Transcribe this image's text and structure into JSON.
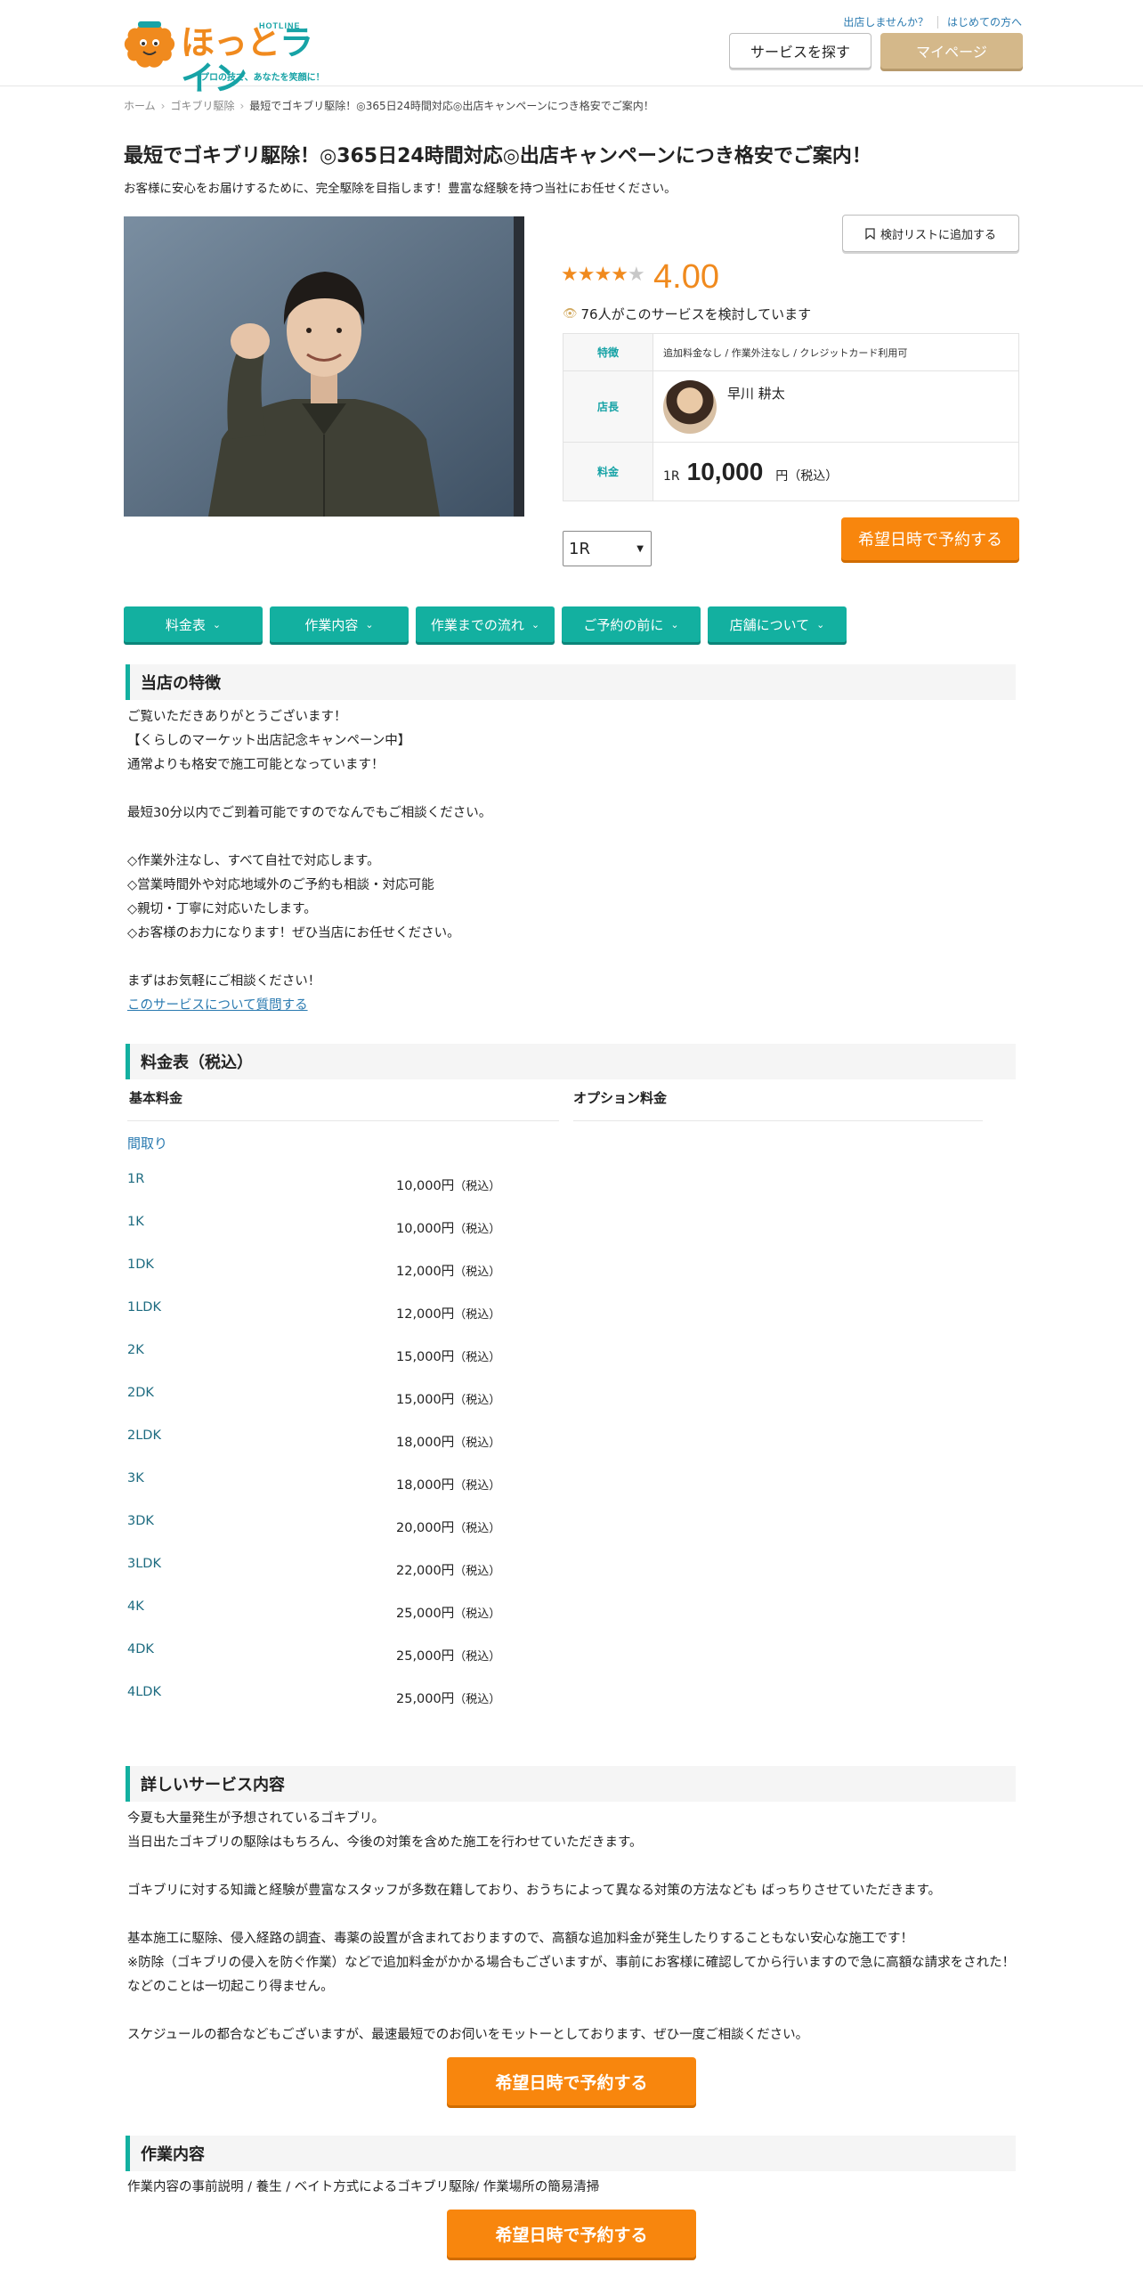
{
  "header": {
    "logo_small": "HOTLINE",
    "logo_word_1": "ほっと",
    "logo_word_2": "ライン",
    "logo_tagline": "プロの技で、あなたを笑顔に！",
    "link_open_shop": "出店しませんか？",
    "link_first_time": "はじめての方へ",
    "search_service_label": "サービスを探す",
    "mypage_label": "マイページ"
  },
  "breadcrumb": {
    "home": "ホーム",
    "category": "ゴキブリ駆除",
    "current": "最短でゴキブリ駆除！◎365日24時間対応◎出店キャンペーンにつき格安でご案内！"
  },
  "service": {
    "title": "最短でゴキブリ駆除！◎365日24時間対応◎出店キャンペーンにつき格安でご案内！",
    "subtitle": "お客様に安心をお届けするために、完全駆除を目指します！豊富な経験を持つ当社にお任せください。",
    "wishlist_label": "検討リストに追加する",
    "rating": "4.00",
    "rating_value": 4,
    "viewers_text": "76人がこのサービスを検討しています",
    "features_label": "特徴",
    "features_value": "追加料金なし / 作業外注なし / クレジットカード利用可",
    "manager_label": "店長",
    "manager_name": "早川 耕太",
    "fee_label": "料金",
    "fee_room": "1R",
    "fee_amount": "10,000",
    "fee_unit": "円（税込）",
    "select_value": "1R",
    "book_label": "希望日時で予約する"
  },
  "tabs": [
    {
      "label": "料金表"
    },
    {
      "label": "作業内容"
    },
    {
      "label": "作業までの流れ"
    },
    {
      "label": "ご予約の前に"
    },
    {
      "label": "店舗について"
    }
  ],
  "features_section": {
    "heading": "当店の特徴",
    "body": "ご覧いただきありがとうございます！\n【くらしのマーケット出店記念キャンペーン中】\n通常よりも格安で施工可能となっています！\n\n最短30分以内でご到着可能ですのでなんでもご相談ください。\n\n◇作業外注なし、すべて自社で対応します。\n◇営業時間外や対応地域外のご予約も相談・対応可能\n◇親切・丁寧に対応いたします。\n◇お客様のお力になります！ぜひ当店にお任せください。\n\nまずはお気軽にご相談ください！",
    "ask_link": "このサービスについて質問する"
  },
  "price_section": {
    "heading": "料金表（税込）",
    "basic_label": "基本料金",
    "option_label": "オプション料金",
    "category": "間取り",
    "rows": [
      {
        "room": "1R",
        "price": "10,000円",
        "tax": "（税込）"
      },
      {
        "room": "1K",
        "price": "10,000円",
        "tax": "（税込）"
      },
      {
        "room": "1DK",
        "price": "12,000円",
        "tax": "（税込）"
      },
      {
        "room": "1LDK",
        "price": "12,000円",
        "tax": "（税込）"
      },
      {
        "room": "2K",
        "price": "15,000円",
        "tax": "（税込）"
      },
      {
        "room": "2DK",
        "price": "15,000円",
        "tax": "（税込）"
      },
      {
        "room": "2LDK",
        "price": "18,000円",
        "tax": "（税込）"
      },
      {
        "room": "3K",
        "price": "18,000円",
        "tax": "（税込）"
      },
      {
        "room": "3DK",
        "price": "20,000円",
        "tax": "（税込）"
      },
      {
        "room": "3LDK",
        "price": "22,000円",
        "tax": "（税込）"
      },
      {
        "room": "4K",
        "price": "25,000円",
        "tax": "（税込）"
      },
      {
        "room": "4DK",
        "price": "25,000円",
        "tax": "（税込）"
      },
      {
        "room": "4LDK",
        "price": "25,000円",
        "tax": "（税込）"
      }
    ]
  },
  "detail_section": {
    "heading": "詳しいサービス内容",
    "body": "今夏も大量発生が予想されているゴキブリ。\n当日出たゴキブリの駆除はもちろん、今後の対策を含めた施工を行わせていただきます。\n\nゴキブリに対する知識と経験が豊富なスタッフが多数在籍しており、おうちによって異なる対策の方法なども ばっちりさせていただきます。\n\n基本施工に駆除、侵入経路の調査、毒薬の設置が含まれておりますので、高額な追加料金が発生したりすることもない安心な施工です！\n※防除（ゴキブリの侵入を防ぐ作業）などで追加料金がかかる場合もございますが、事前にお客様に確認してから行いますので急に高額な請求をされた！などのことは一切起こり得ません。\n\nスケジュールの都合などもございますが、最速最短でのお伺いをモットーとしております、ぜひ一度ご相談ください。",
    "book_label": "希望日時で予約する"
  },
  "work_section": {
    "heading": "作業内容",
    "body": "作業内容の事前説明 / 養生 / ベイト方式によるゴキブリ駆除/ 作業場所の簡易清掃",
    "book_label": "希望日時で予約する"
  },
  "colors": {
    "accent_teal": "#13b0a0",
    "accent_orange": "#f8860d",
    "mypage_tan": "#d4b88a",
    "link_blue": "#2a7ab0"
  }
}
